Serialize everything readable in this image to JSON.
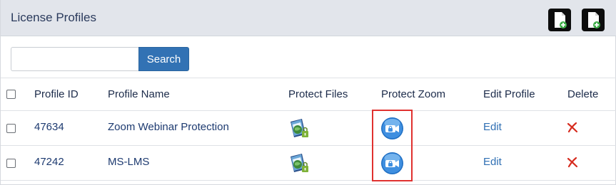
{
  "header": {
    "title": "License Profiles",
    "add_buttons": [
      "add-document-icon",
      "add-document-icon"
    ]
  },
  "search": {
    "value": "",
    "placeholder": "",
    "button_label": "Search"
  },
  "table": {
    "columns": [
      "Profile ID",
      "Profile Name",
      "Protect Files",
      "Protect Zoom",
      "Edit Profile",
      "Delete"
    ],
    "rows": [
      {
        "id": "47634",
        "name": "Zoom Webinar Protection",
        "protect_files": "protect-files-icon",
        "protect_zoom": "protect-zoom-icon",
        "edit": "Edit",
        "delete": "delete-x-icon"
      },
      {
        "id": "47242",
        "name": "MS-LMS",
        "protect_files": "protect-files-icon",
        "protect_zoom": "protect-zoom-icon",
        "edit": "Edit",
        "delete": "delete-x-icon"
      }
    ]
  },
  "colors": {
    "header_bg": "#e2e5eb",
    "search_button": "#3272b4",
    "link": "#2f6fb3",
    "highlight": "#e0312f",
    "delete": "#d62c1f"
  }
}
